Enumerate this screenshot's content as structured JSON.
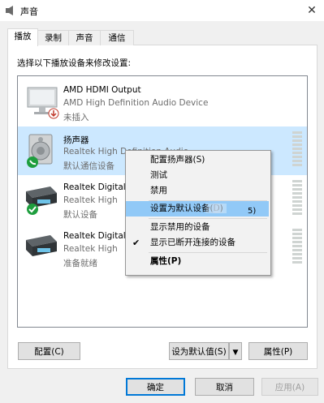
{
  "window": {
    "title": "声音",
    "close_symbol": "✕"
  },
  "tabs": [
    {
      "label": "播放",
      "active": true
    },
    {
      "label": "录制",
      "active": false
    },
    {
      "label": "声音",
      "active": false
    },
    {
      "label": "通信",
      "active": false
    }
  ],
  "instruction": "选择以下播放设备来修改设置:",
  "devices": [
    {
      "name": "AMD HDMI Output",
      "desc": "AMD High Definition Audio Device",
      "status": "未插入",
      "icon": "monitor-icon",
      "badge": "unplugged-badge"
    },
    {
      "name": "扬声器",
      "desc": "Realtek High Definition Audio",
      "status": "默认通信设备",
      "icon": "speaker-icon",
      "badge": "phone-badge"
    },
    {
      "name": "Realtek Digital",
      "desc": "Realtek High",
      "status": "默认设备",
      "icon": "digital-output-icon",
      "badge": "check-badge"
    },
    {
      "name": "Realtek Digital",
      "desc": "Realtek High",
      "status": "准备就绪",
      "icon": "digital-output-icon",
      "badge": ""
    }
  ],
  "context_menu": {
    "items": [
      {
        "label": "配置扬声器(S)"
      },
      {
        "label": "测试"
      },
      {
        "label": "禁用"
      },
      {
        "label": "设置为默认设备(D)"
      },
      {
        "label": "显示禁用的设备"
      },
      {
        "label": "显示已断开连接的设备",
        "checked": true
      },
      {
        "label": "属性(P)"
      }
    ],
    "overlap_fragment": "5)",
    "default_fragment": "默认"
  },
  "buttons": {
    "configure": "配置(C)",
    "set_default": "设为默认值(S)",
    "set_default_arrow": "▼",
    "properties": "属性(P)",
    "ok": "确定",
    "cancel": "取消",
    "apply": "应用(A)"
  },
  "colors": {
    "selection": "#cce8ff",
    "menu_hover": "#91c9f7",
    "accent": "#0078d7"
  }
}
